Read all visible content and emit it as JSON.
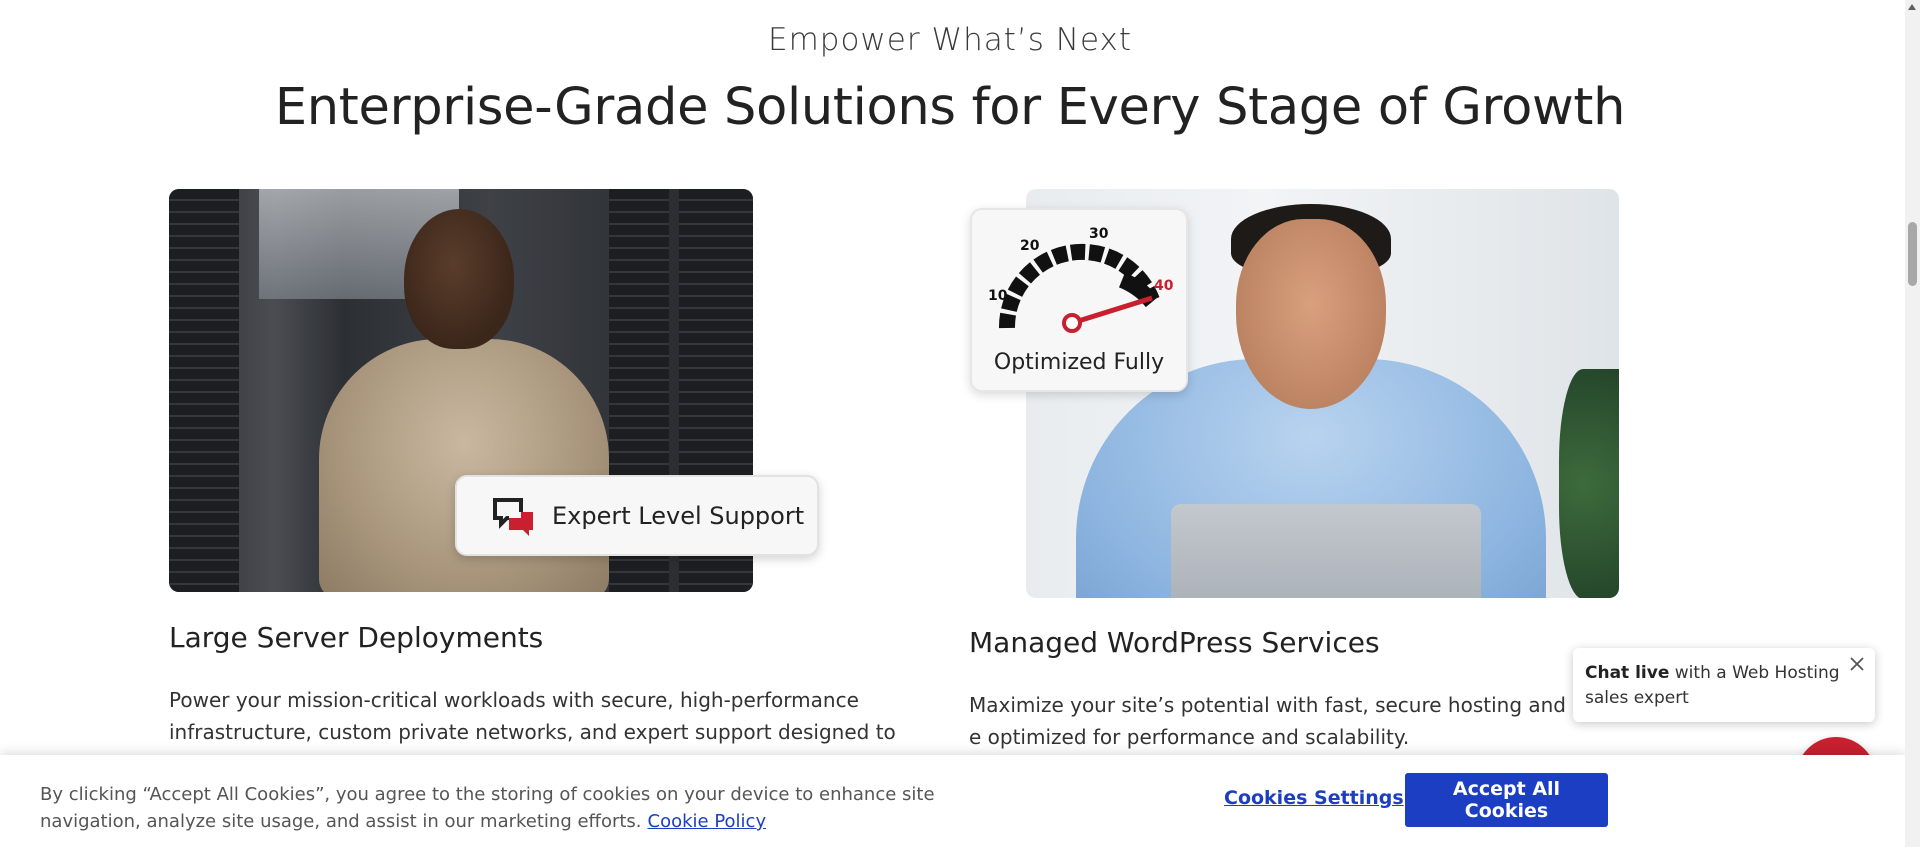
{
  "section": {
    "eyebrow": "Empower What’s Next",
    "headline": "Enterprise-Grade Solutions for Every Stage of Growth"
  },
  "cards": [
    {
      "badge_label": "Expert Level Support",
      "badge_icon": "chat-support-icon",
      "title": "Large Server Deployments",
      "text": "Power your mission-critical workloads with secure, high-performance infrastructure, custom private networks, and expert support designed to"
    },
    {
      "badge_label": "Optimized Fully",
      "badge_icon": "speedometer-icon",
      "gauge_ticks": [
        "10",
        "20",
        "30",
        "40"
      ],
      "title": "Managed WordPress Services",
      "text": "Maximize your site’s potential with fast, secure hosting and e optimized for performance and scalability."
    }
  ],
  "chat": {
    "bold": "Chat live",
    "rest": " with a Web Hosting sales expert",
    "close_icon": "close-icon",
    "fab_icon": "chat-bubble-icon"
  },
  "cookie": {
    "text": "By clicking “Accept All Cookies”, you agree to the storing of cookies on your device to enhance site navigation, analyze site usage, and assist in our marketing efforts.",
    "policy_link": "Cookie Policy",
    "settings_label": "Cookies Settings",
    "accept_label": "Accept All Cookies"
  },
  "colors": {
    "accent_blue": "#1b3ec2",
    "chat_red": "#c8202f"
  }
}
